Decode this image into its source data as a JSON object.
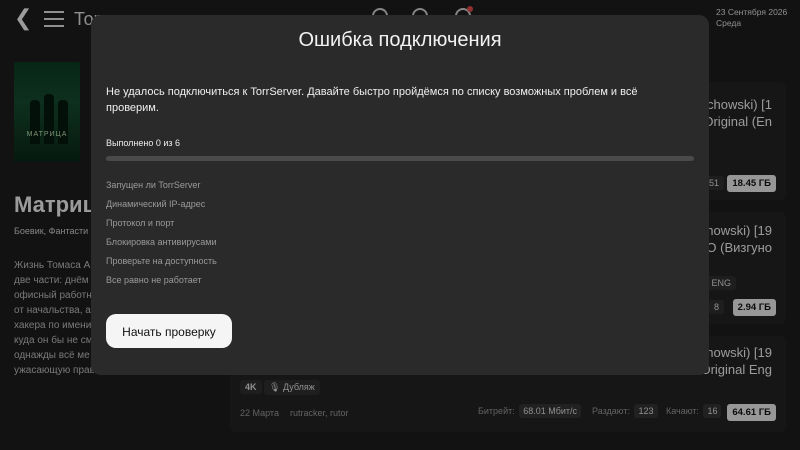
{
  "header": {
    "title": "Тор",
    "date": "23 Сентября 2026",
    "weekday": "Среда",
    "icons": [
      "search-icon",
      "spinner-icon",
      "notification-icon",
      "settings-icon",
      "account-icon"
    ]
  },
  "movie": {
    "poster_title": "МАТРИЦА",
    "title": "Матриц",
    "genres": "Боевик, Фантасти",
    "description_lines": [
      "Жизнь Томаса А",
      "две части: днём",
      "офисный работн",
      "от начальства, а",
      "хакера по имени",
      "куда он бы не см",
      "однажды всё ме",
      "ужасающую прав"
    ]
  },
  "torrents": [
    {
      "title": "achowski) [1 Original (En",
      "chip": "51",
      "size": "18.45 ГБ"
    },
    {
      "title": "achowski) [19 О (Визгуно",
      "chips": [
        "ENG",
        "8"
      ],
      "size": "2.94 ГБ"
    },
    {
      "title": "achowski) [19 Original Eng",
      "quality": "4K",
      "dub": "Дубляж",
      "date": "22 Марта",
      "trackers": "rutracker, rutor",
      "bitrate_label": "Битрейт:",
      "bitrate": "68.01 Мбит/с",
      "seeders_label": "Раздают:",
      "seeders": "123",
      "leechers_label": "Качают:",
      "leechers": "16",
      "size": "64.61 ГБ"
    }
  ],
  "dialog": {
    "title": "Ошибка подключения",
    "message": "Не удалось подключиться к TorrServer. Давайте быстро пройдёмся по списку возможных проблем и всё проверим.",
    "progress_text": "Выполнено 0 из 6",
    "progress_fraction": 0,
    "steps": [
      "Запущен ли TorrServer",
      "Динамический IP-адрес",
      "Протокол и порт",
      "Блокировка антивирусами",
      "Проверьте на доступность",
      "Все равно не работает"
    ],
    "start_button": "Начать проверку"
  }
}
